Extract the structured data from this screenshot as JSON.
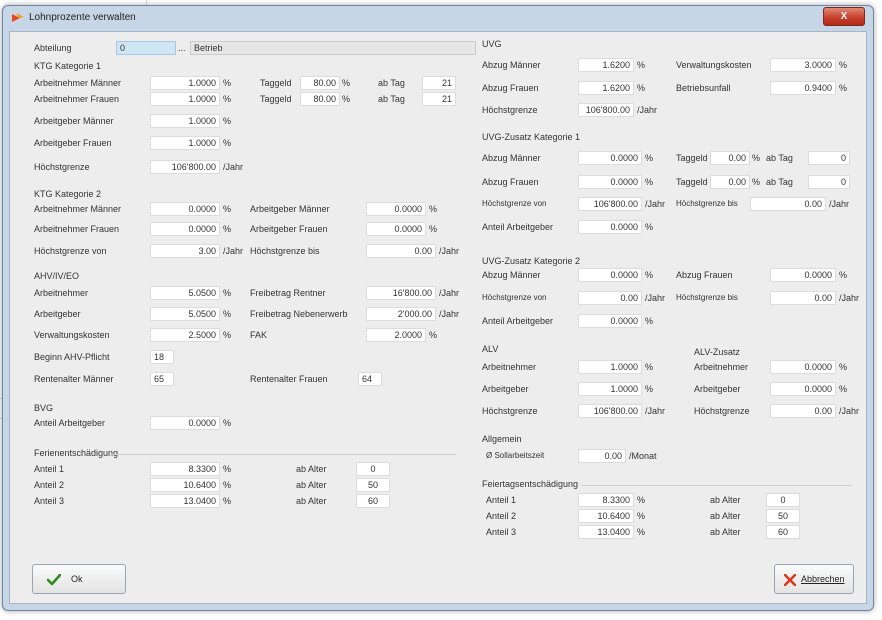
{
  "window": {
    "title": "Lohnprozente verwalten",
    "close_label": "X"
  },
  "header": {
    "abteilung_label": "Abteilung",
    "abteilung_value": "0",
    "abteilung_dots": "...",
    "betrieb_value": "Betrieb"
  },
  "ktg1": {
    "title": "KTG Kategorie 1",
    "an_maenner_label": "Arbeitnehmer Männer",
    "an_maenner_value": "1.0000",
    "an_maenner_unit": "%",
    "an_frauen_label": "Arbeitnehmer Frauen",
    "an_frauen_value": "1.0000",
    "an_frauen_unit": "%",
    "taggeld1_label": "Taggeld",
    "taggeld1_value": "80.00",
    "taggeld1_unit": "%",
    "abtag1_label": "ab Tag",
    "abtag1_value": "21",
    "taggeld2_label": "Taggeld",
    "taggeld2_value": "80.00",
    "taggeld2_unit": "%",
    "abtag2_label": "ab Tag",
    "abtag2_value": "21",
    "ag_maenner_label": "Arbeitgeber Männer",
    "ag_maenner_value": "1.0000",
    "ag_maenner_unit": "%",
    "ag_frauen_label": "Arbeitgeber Frauen",
    "ag_frauen_value": "1.0000",
    "ag_frauen_unit": "%",
    "hoechst_label": "Höchstgrenze",
    "hoechst_value": "106'800.00",
    "hoechst_unit": "/Jahr"
  },
  "ktg2": {
    "title": "KTG Kategorie 2",
    "an_maenner_label": "Arbeitnehmer Männer",
    "an_maenner_value": "0.0000",
    "an_maenner_unit": "%",
    "an_frauen_label": "Arbeitnehmer Frauen",
    "an_frauen_value": "0.0000",
    "an_frauen_unit": "%",
    "ag_maenner_label": "Arbeitgeber Männer",
    "ag_maenner_value": "0.0000",
    "ag_maenner_unit": "%",
    "ag_frauen_label": "Arbeitgeber Frauen",
    "ag_frauen_value": "0.0000",
    "ag_frauen_unit": "%",
    "hg_von_label": "Höchstgrenze von",
    "hg_von_value": "3.00",
    "hg_von_unit": "/Jahr",
    "hg_bis_label": "Höchstgrenze bis",
    "hg_bis_value": "0.00",
    "hg_bis_unit": "/Jahr"
  },
  "ahv": {
    "title": "AHV/IV/EO",
    "an_label": "Arbeitnehmer",
    "an_value": "5.0500",
    "an_unit": "%",
    "ag_label": "Arbeitgeber",
    "ag_value": "5.0500",
    "ag_unit": "%",
    "vk_label": "Verwaltungskosten",
    "vk_value": "2.5000",
    "vk_unit": "%",
    "fb_rentner_label": "Freibetrag Rentner",
    "fb_rentner_value": "16'800.00",
    "fb_rentner_unit": "/Jahr",
    "fb_neben_label": "Freibetrag Nebenerwerb",
    "fb_neben_value": "2'000.00",
    "fb_neben_unit": "/Jahr",
    "fak_label": "FAK",
    "fak_value": "2.0000",
    "fak_unit": "%",
    "beginn_label": "Beginn AHV-Pflicht",
    "beginn_value": "18",
    "ra_maenner_label": "Rentenalter Männer",
    "ra_maenner_value": "65",
    "ra_frauen_label": "Rentenalter Frauen",
    "ra_frauen_value": "64"
  },
  "bvg": {
    "title": "BVG",
    "ag_label": "Anteil Arbeitgeber",
    "ag_value": "0.0000",
    "ag_unit": "%"
  },
  "ferien": {
    "title": "Ferienentschädigung",
    "rows": [
      {
        "label": "Anteil 1",
        "value": "8.3300",
        "unit": "%",
        "age_label": "ab Alter",
        "age_value": "0"
      },
      {
        "label": "Anteil 2",
        "value": "10.6400",
        "unit": "%",
        "age_label": "ab Alter",
        "age_value": "50"
      },
      {
        "label": "Anteil 3",
        "value": "13.0400",
        "unit": "%",
        "age_label": "ab Alter",
        "age_value": "60"
      }
    ]
  },
  "uvg": {
    "title": "UVG",
    "m_label": "Abzug Männer",
    "m_value": "1.6200",
    "m_unit": "%",
    "f_label": "Abzug Frauen",
    "f_value": "1.6200",
    "f_unit": "%",
    "hg_label": "Höchstgrenze",
    "hg_value": "106'800.00",
    "hg_unit": "/Jahr",
    "vk_label": "Verwaltungskosten",
    "vk_value": "3.0000",
    "vk_unit": "%",
    "bu_label": "Betriebsunfall",
    "bu_value": "0.9400",
    "bu_unit": "%"
  },
  "uvgz1": {
    "title": "UVG-Zusatz Kategorie 1",
    "m_label": "Abzug Männer",
    "m_value": "0.0000",
    "m_unit": "%",
    "f_label": "Abzug Frauen",
    "f_value": "0.0000",
    "f_unit": "%",
    "tg1_label": "Taggeld",
    "tg1_value": "0.00",
    "tg1_unit": "%",
    "abtag1_label": "ab Tag",
    "abtag1_value": "0",
    "tg2_label": "Taggeld",
    "tg2_value": "0.00",
    "tg2_unit": "%",
    "abtag2_label": "ab Tag",
    "abtag2_value": "0",
    "hg_von_label": "Höchstgrenze von",
    "hg_von_value": "106'800.00",
    "hg_von_unit": "/Jahr",
    "hg_bis_label": "Höchstgrenze bis",
    "hg_bis_value": "0.00",
    "hg_bis_unit": "/Jahr",
    "ag_label": "Anteil Arbeitgeber",
    "ag_value": "0.0000",
    "ag_unit": "%"
  },
  "uvgz2": {
    "title": "UVG-Zusatz Kategorie 2",
    "m_label": "Abzug Männer",
    "m_value": "0.0000",
    "m_unit": "%",
    "f_label": "Abzug Frauen",
    "f_value": "0.0000",
    "f_unit": "%",
    "hg_von_label": "Höchstgrenze von",
    "hg_von_value": "0.00",
    "hg_von_unit": "/Jahr",
    "hg_bis_label": "Höchstgrenze bis",
    "hg_bis_value": "0.00",
    "hg_bis_unit": "/Jahr",
    "ag_label": "Anteil Arbeitgeber",
    "ag_value": "0.0000",
    "ag_unit": "%"
  },
  "alv": {
    "title": "ALV",
    "an_label": "Arbeitnehmer",
    "an_value": "1.0000",
    "an_unit": "%",
    "ag_label": "Arbeitgeber",
    "ag_value": "1.0000",
    "ag_unit": "%",
    "hg_label": "Höchstgrenze",
    "hg_value": "106'800.00",
    "hg_unit": "/Jahr"
  },
  "alvz": {
    "title": "ALV-Zusatz",
    "an_label": "Arbeitnehmer",
    "an_value": "0.0000",
    "an_unit": "%",
    "ag_label": "Arbeitgeber",
    "ag_value": "0.0000",
    "ag_unit": "%",
    "hg_label": "Höchstgrenze",
    "hg_value": "0.00",
    "hg_unit": "/Jahr"
  },
  "allgemein": {
    "title": "Allgemein",
    "soll_label": "Ø Sollarbeitszeit",
    "soll_value": "0.00",
    "soll_unit": "/Monat"
  },
  "feiertag": {
    "title": "Feiertagsentschädigung",
    "rows": [
      {
        "label": "Anteil 1",
        "value": "8.3300",
        "unit": "%",
        "age_label": "ab Alter",
        "age_value": "0"
      },
      {
        "label": "Anteil 2",
        "value": "10.6400",
        "unit": "%",
        "age_label": "ab Alter",
        "age_value": "50"
      },
      {
        "label": "Anteil 3",
        "value": "13.0400",
        "unit": "%",
        "age_label": "ab Alter",
        "age_value": "60"
      }
    ]
  },
  "buttons": {
    "ok_label": "Ok",
    "cancel_label": "Abbrechen"
  },
  "colors": {
    "accent_green": "#2e8b1e",
    "accent_red": "#d93a1c",
    "window_frame": "#c7d6e6"
  }
}
